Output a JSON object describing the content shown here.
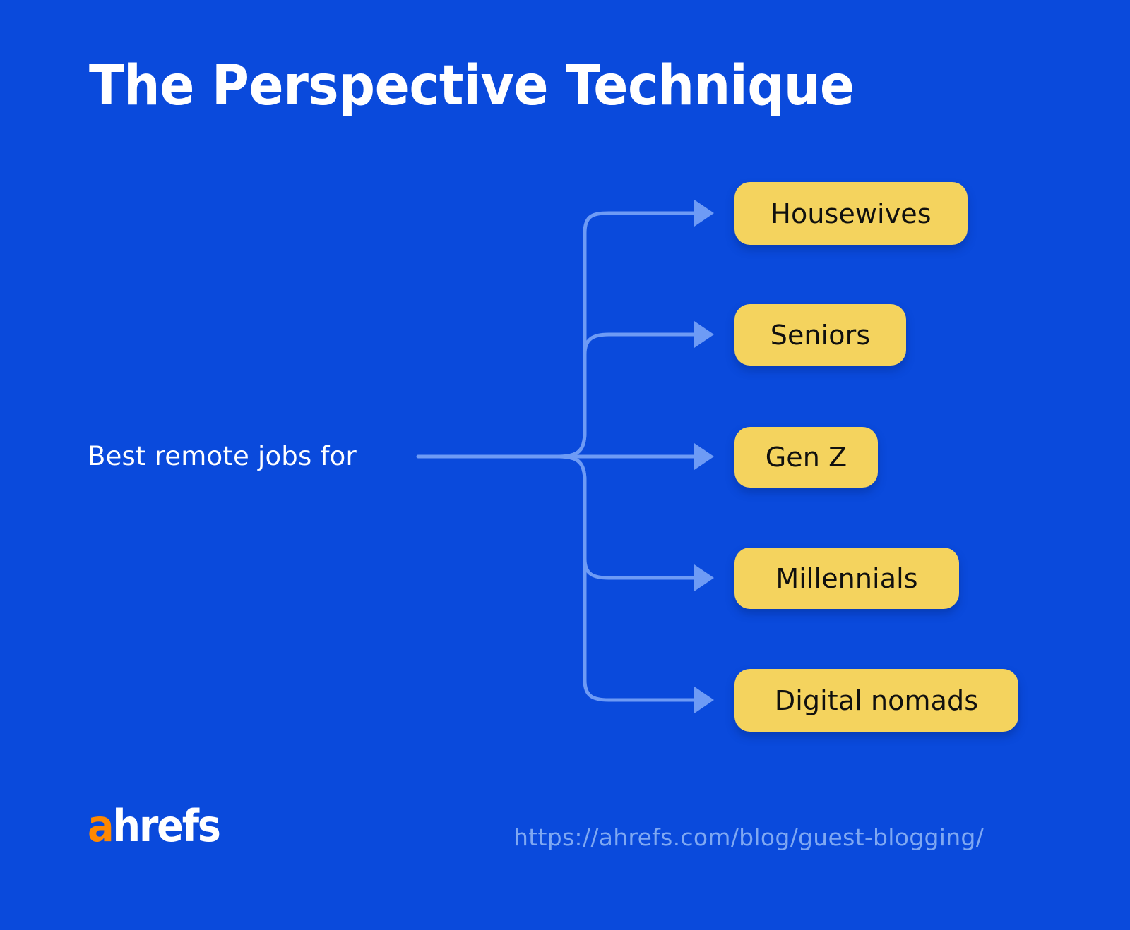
{
  "theme": {
    "background_color": "#0A4ADC",
    "title_color": "#FFFFFF",
    "node_fill": "#F4D35E",
    "node_text_color": "#10100F",
    "connector_color": "#6E9BF5",
    "footer_url_color": "#7FA8F2",
    "logo_accent_color": "#FF8800"
  },
  "header": {
    "title": "The Perspective Technique"
  },
  "diagram": {
    "root": {
      "label": "Best remote jobs for"
    },
    "branches": [
      {
        "label": "Housewives"
      },
      {
        "label": "Seniors"
      },
      {
        "label": "Gen Z"
      },
      {
        "label": "Millennials"
      },
      {
        "label": "Digital nomads"
      }
    ]
  },
  "footer": {
    "logo_accent": "a",
    "logo_rest": "hrefs",
    "url": "https://ahrefs.com/blog/guest-blogging/"
  }
}
